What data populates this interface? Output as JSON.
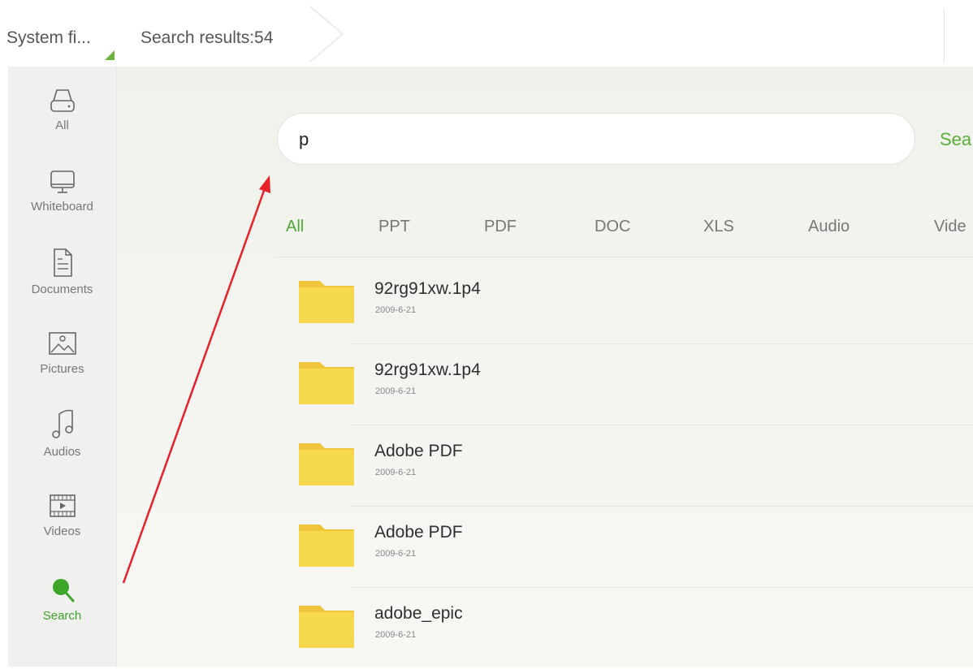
{
  "breadcrumb": {
    "root_label": "System fi...",
    "current_label": "Search results:54"
  },
  "sidebar": {
    "items": [
      {
        "label": "All",
        "icon": "drive-icon"
      },
      {
        "label": "Whiteboard",
        "icon": "monitor-icon"
      },
      {
        "label": "Documents",
        "icon": "document-icon"
      },
      {
        "label": "Pictures",
        "icon": "picture-icon"
      },
      {
        "label": "Audios",
        "icon": "music-note-icon"
      },
      {
        "label": "Videos",
        "icon": "video-icon"
      },
      {
        "label": "Search",
        "icon": "search-icon",
        "active": true
      }
    ]
  },
  "search": {
    "value": "p",
    "button_label": "Sea"
  },
  "tabs": [
    {
      "label": "All",
      "active": true
    },
    {
      "label": "PPT"
    },
    {
      "label": "PDF"
    },
    {
      "label": "DOC"
    },
    {
      "label": "XLS"
    },
    {
      "label": "Audio"
    },
    {
      "label": "Vide"
    }
  ],
  "files": [
    {
      "name": "92rg91xw.1p4",
      "date": "2009-6-21"
    },
    {
      "name": "92rg91xw.1p4",
      "date": "2009-6-21"
    },
    {
      "name": "Adobe PDF",
      "date": "2009-6-21"
    },
    {
      "name": "Adobe PDF",
      "date": "2009-6-21"
    },
    {
      "name": "adobe_epic",
      "date": "2009-6-21"
    }
  ],
  "colors": {
    "accent_green": "#4ea832",
    "folder_yellow": "#f5d34a",
    "annotation_red": "#e8202a"
  }
}
